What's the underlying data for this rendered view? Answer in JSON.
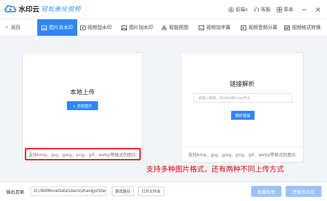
{
  "titlebar": {
    "brand": "水印云",
    "slogan": "轻松美化视频",
    "actions": [
      {
        "icon": "bell-icon",
        "label": "前端s"
      },
      {
        "icon": "headset-icon",
        "label": "客服"
      },
      {
        "icon": "menu-icon",
        "label": "菜单"
      }
    ]
  },
  "nav": {
    "back_label": "返回",
    "tabs": [
      {
        "icon": "image-icon",
        "label": "图片去水印"
      },
      {
        "icon": "video-icon",
        "label": "视频加水印"
      },
      {
        "icon": "image-add-icon",
        "label": "图片加水印"
      },
      {
        "icon": "cutout-icon",
        "label": "智能抠图"
      },
      {
        "icon": "subtitle-icon",
        "label": "视频加字幕"
      },
      {
        "icon": "audio-split-icon",
        "label": "视频音频分离"
      },
      {
        "icon": "convert-icon",
        "label": "视频格式转换"
      }
    ]
  },
  "upload_panel": {
    "title": "本地上传",
    "button": "+ 添加图片",
    "formats": "支持bmp、jpg、jpeg、png、gif、webp等格式的图片"
  },
  "link_panel": {
    "title": "链接解析",
    "placeholder": "请输入链接，仅http或https开头",
    "button": "解析链接",
    "formats": "支持bmp、jpg、jpeg、png、gif、webp等格式的图片"
  },
  "annotation": "支持多种图片格式，还有两种不同上传方式",
  "bottom": {
    "output_label": "输出目录",
    "output_path": "D:\\360MoveData\\Users\\zhangyz\\Des",
    "change_path": "更改路径",
    "open_folder": "打开文件夹",
    "batch_button": "批量处理",
    "start_button": "开始去水印"
  },
  "colors": {
    "accent": "#2f86f6",
    "annotation_red": "#e60012",
    "disabled_button": "#9cc3f7"
  }
}
